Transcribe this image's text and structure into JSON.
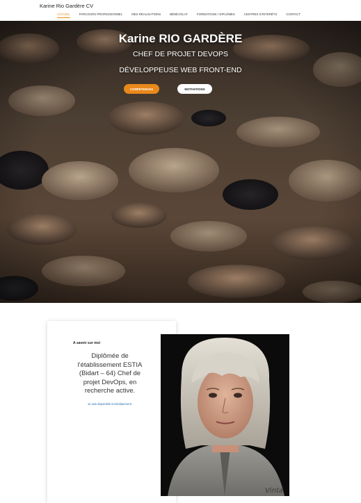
{
  "header": {
    "site_title": "Karine Rio Gardère CV",
    "nav": [
      {
        "label": "ACCUEIL",
        "active": true
      },
      {
        "label": "PARCOURS PROFESSIONNEL",
        "active": false
      },
      {
        "label": "MES RÉALISATIONS",
        "active": false
      },
      {
        "label": "BÉNÉVOLAT",
        "active": false
      },
      {
        "label": "FORMATIONS / DIPLÔMES",
        "active": false
      },
      {
        "label": "CENTRES D'INTÉRÊTS",
        "active": false
      },
      {
        "label": "CONTACT",
        "active": false
      }
    ]
  },
  "hero": {
    "name": "Karine RIO GARDÈRE",
    "subtitle1": "CHEF DE PROJET DEVOPS",
    "subtitle2": "DÉVELOPPEUSE WEB FRONT-END",
    "buttons": {
      "competences": "COMPÉTENCES",
      "motivations": "MOTIVATIONS"
    }
  },
  "about": {
    "heading": "A savoir sur moi",
    "text": "Diplômée de l'établissement ESTIA (Bidart – 64) Chef de projet DevOps, en recherche active.",
    "availability": "Je suis disponible immédiatement."
  },
  "colors": {
    "accent": "#e8891c",
    "link": "#2a6fb0"
  }
}
